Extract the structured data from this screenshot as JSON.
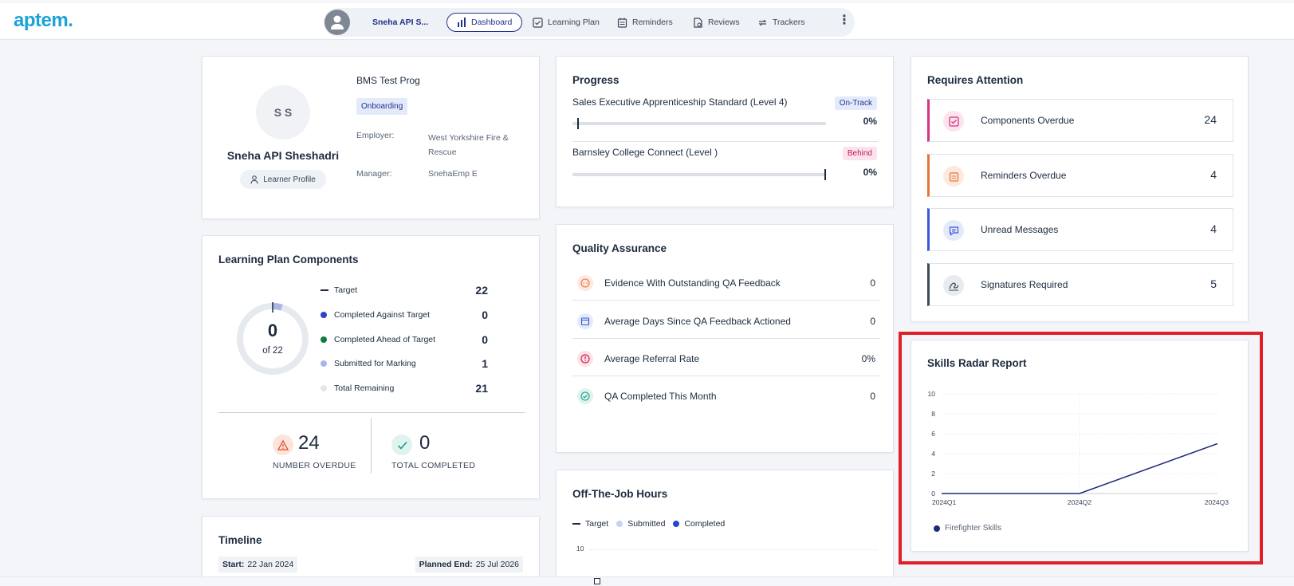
{
  "app": {
    "logo": "aptem."
  },
  "nav": {
    "learner_short": "Sneha API S...",
    "tabs": [
      {
        "label": "Dashboard",
        "active": true
      },
      {
        "label": "Learning Plan"
      },
      {
        "label": "Reminders"
      },
      {
        "label": "Reviews"
      },
      {
        "label": "Trackers"
      }
    ],
    "more": "⋮"
  },
  "profile": {
    "initials": "S S",
    "name": "Sneha API Sheshadri",
    "profile_button": "Learner Profile",
    "programme": "BMS Test Prog",
    "status": "Onboarding",
    "employer_label": "Employer:",
    "employer_value": "West Yorkshire Fire & Rescue",
    "manager_label": "Manager:",
    "manager_value": "SnehaEmp E"
  },
  "progress": {
    "title": "Progress",
    "items": [
      {
        "name": "Sales Executive Apprenticeship Standard (Level 4)",
        "status": "On-Track",
        "percent": "0%",
        "progress": 0,
        "target": 0
      },
      {
        "name": "Barnsley College Connect (Level )",
        "status": "Behind",
        "percent": "0%",
        "progress": 0,
        "target": 1
      }
    ]
  },
  "attention": {
    "title": "Requires Attention",
    "items": [
      {
        "label": "Components Overdue",
        "value": "24",
        "color": "#d63384"
      },
      {
        "label": "Reminders Overdue",
        "value": "4",
        "color": "#e8743b"
      },
      {
        "label": "Unread Messages",
        "value": "4",
        "color": "#3a58d8"
      },
      {
        "label": "Signatures Required",
        "value": "5",
        "color": "#3d4a5c"
      }
    ]
  },
  "lpc": {
    "title": "Learning Plan Components",
    "donut_value": "0",
    "donut_sub": "of 22",
    "legend": [
      {
        "label": "Target",
        "value": "22",
        "color": "#1d2b3f",
        "marker": "line"
      },
      {
        "label": "Completed Against Target",
        "value": "0",
        "color": "#2a45c9"
      },
      {
        "label": "Completed Ahead of Target",
        "value": "0",
        "color": "#137a3e"
      },
      {
        "label": "Submitted for Marking",
        "value": "1",
        "color": "#a9b5e8"
      },
      {
        "label": "Total Remaining",
        "value": "21",
        "color": "#e3e6ea"
      }
    ],
    "overdue_value": "24",
    "overdue_label": "NUMBER OVERDUE",
    "completed_value": "0",
    "completed_label": "TOTAL COMPLETED"
  },
  "qa": {
    "title": "Quality Assurance",
    "items": [
      {
        "label": "Evidence With Outstanding QA Feedback",
        "value": "0",
        "color": "#e8743b"
      },
      {
        "label": "Average Days Since QA Feedback Actioned",
        "value": "0",
        "color": "#3a58d8"
      },
      {
        "label": "Average Referral Rate",
        "value": "0%",
        "color": "#d6204f"
      },
      {
        "label": "QA Completed This Month",
        "value": "0",
        "color": "#1f9e8a"
      }
    ]
  },
  "timeline": {
    "title": "Timeline",
    "start_label": "Start:",
    "start_value": "22 Jan 2024",
    "end_label": "Planned End:",
    "end_value": "25 Jul 2026"
  },
  "otj": {
    "title": "Off-The-Job Hours",
    "legend": [
      {
        "label": "Target",
        "color": "#1d2b3f"
      },
      {
        "label": "Submitted",
        "color": "#c9d1f2"
      },
      {
        "label": "Completed",
        "color": "#2a45c9"
      }
    ],
    "y_top": "10"
  },
  "radar": {
    "title": "Skills Radar Report"
  },
  "chart_data": {
    "type": "line",
    "title": "Skills Radar Report",
    "x": [
      "2024Q1",
      "2024Q2",
      "2024Q3"
    ],
    "series": [
      {
        "name": "Firefighter Skills",
        "values": [
          0,
          0,
          5
        ],
        "color": "#1f2a7a"
      }
    ],
    "yticks": [
      "0",
      "2",
      "4",
      "6",
      "8",
      "10"
    ],
    "ylim": [
      0,
      10
    ],
    "grid": true,
    "legend": "bottom-left"
  }
}
